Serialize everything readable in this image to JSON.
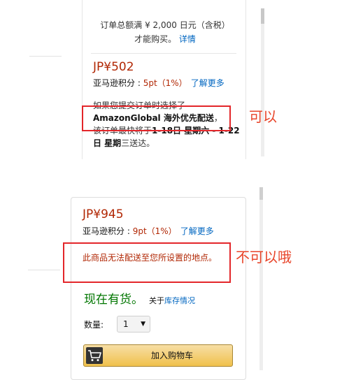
{
  "top_panel": {
    "min_order_line1": "订单总额满 ¥ 2,000 日元（含税）",
    "min_order_line2": "才能购买。",
    "details_link": "详情",
    "price": "JP¥502",
    "points_label": "亚马逊积分 : ",
    "points_value": "5pt（1%）",
    "learn_more": "了解更多",
    "ship_line1": "如果您提交订单时选择了",
    "ship_bold": "AmazonGlobal 海外优先配送",
    "ship_comma": "，",
    "ship_line3": "该订单最快将于",
    "ship_date_bold": "1-18日 星期六 - 1-22日 星期",
    "ship_tail": "三送达。",
    "annotation": "可以"
  },
  "bottom_panel": {
    "price": "JP¥945",
    "points_label": "亚马逊积分 : ",
    "points_value": "9pt（1%）",
    "learn_more": "了解更多",
    "no_ship_message": "此商品无法配送至您所设置的地点。",
    "annotation": "不可以哦",
    "in_stock": "现在有货。",
    "about_prefix": "关于",
    "about_link": "库存情况",
    "quantity_label": "数量:",
    "quantity_value": "1",
    "add_to_cart": "加入购物车"
  },
  "icons": {
    "cart": "shopping-cart-icon",
    "dropdown": "chevron-down-icon"
  },
  "colors": {
    "price": "#b12704",
    "link": "#0066c0",
    "in_stock": "#007600",
    "annotation_box": "#e3262a",
    "annotation_text": "#e8452a",
    "cart_button": "#f0c14b"
  }
}
